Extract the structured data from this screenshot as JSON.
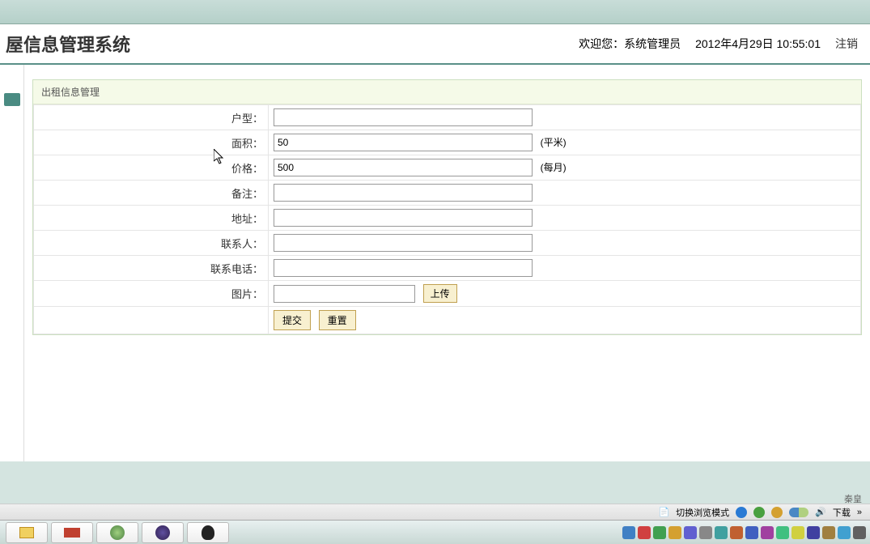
{
  "app": {
    "title": "屋信息管理系统"
  },
  "header": {
    "welcome": "欢迎您：系统管理员",
    "datetime": "2012年4月29日  10:55:01",
    "logout": "注销"
  },
  "panel": {
    "title": "出租信息管理"
  },
  "form": {
    "fields": {
      "house_type": {
        "label": "户型：",
        "value": ""
      },
      "area": {
        "label": "面积：",
        "value": "50",
        "unit": "(平米)"
      },
      "price": {
        "label": "价格：",
        "value": "500",
        "unit": "(每月)"
      },
      "remark": {
        "label": "备注：",
        "value": ""
      },
      "address": {
        "label": "地址：",
        "value": ""
      },
      "contact": {
        "label": "联系人：",
        "value": ""
      },
      "phone": {
        "label": "联系电话：",
        "value": ""
      },
      "image": {
        "label": "图片：",
        "value": "",
        "upload_btn": "上传"
      }
    },
    "buttons": {
      "submit": "提交",
      "reset": "重置"
    }
  },
  "browser_bar": {
    "mode_switch": "切换浏览模式",
    "download": "下载"
  },
  "footer_text": "秦皇"
}
